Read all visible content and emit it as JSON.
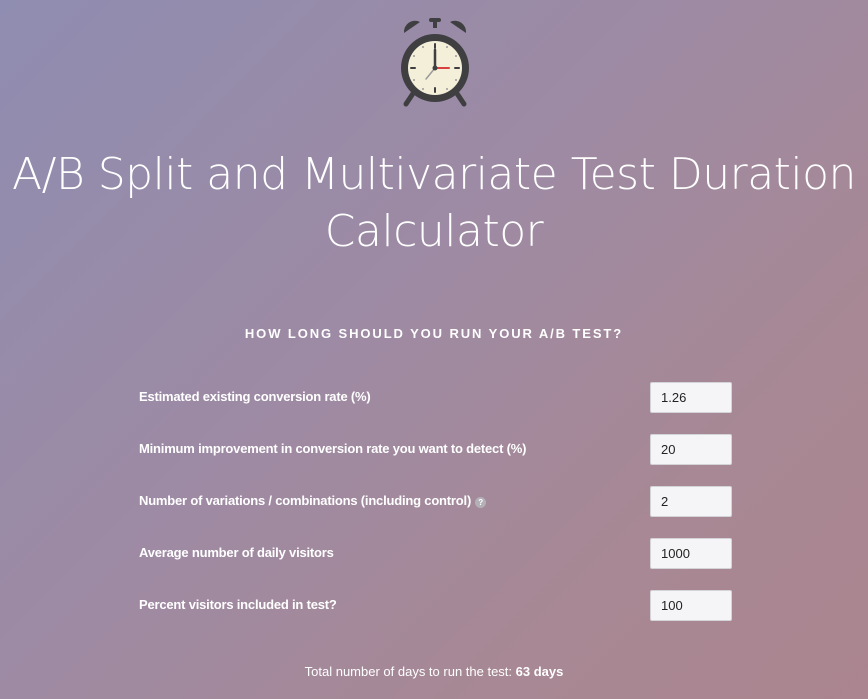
{
  "header": {
    "title_line1": "A/B Split and Multivariate Test Duration",
    "title_line2": "Calculator",
    "icon": "alarm-clock-icon"
  },
  "calculator": {
    "heading": "HOW LONG SHOULD YOU RUN YOUR A/B TEST?",
    "fields": [
      {
        "label": "Estimated existing conversion rate (%)",
        "value": "1.26"
      },
      {
        "label": "Minimum improvement in conversion rate you want to detect (%)",
        "value": "20"
      },
      {
        "label": "Number of variations / combinations (including control)",
        "value": "2",
        "help_icon": "?"
      },
      {
        "label": "Average number of daily visitors",
        "value": "1000"
      },
      {
        "label": "Percent visitors included in test?",
        "value": "100"
      }
    ],
    "result_label": "Total number of days to run the test:",
    "result_value": "63 days"
  },
  "colors": {
    "background_start": "#8f8db1",
    "background_end": "#ab8590",
    "clock_body": "#3f3f41",
    "clock_face": "#f3efd9",
    "second_hand": "#d94040"
  }
}
